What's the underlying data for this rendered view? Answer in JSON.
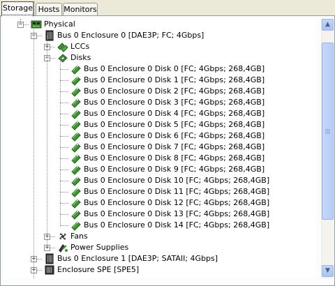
{
  "tabs": [
    {
      "label": "Storage",
      "active": true
    },
    {
      "label": "Hosts",
      "active": false
    },
    {
      "label": "Monitors",
      "active": false
    }
  ],
  "tree": {
    "root": {
      "label": "Physical",
      "icon": "board-icon",
      "expanded": true
    },
    "enclosure0": {
      "label": "Bus 0 Enclosure 0 [DAE3P; FC; 4Gbps]",
      "icon": "enclosure-icon",
      "expanded": true
    },
    "lccs": {
      "label": "LCCs",
      "icon": "lcc-icon",
      "expanded": false
    },
    "disks": {
      "label": "Disks",
      "icon": "disks-group-icon",
      "expanded": true
    },
    "disk_items": [
      "Bus 0 Enclosure 0 Disk 0 [FC; 4Gbps; 268,4GB]",
      "Bus 0 Enclosure 0 Disk 1 [FC; 4Gbps; 268,4GB]",
      "Bus 0 Enclosure 0 Disk 2 [FC; 4Gbps; 268,4GB]",
      "Bus 0 Enclosure 0 Disk 3 [FC; 4Gbps; 268,4GB]",
      "Bus 0 Enclosure 0 Disk 4 [FC; 4Gbps; 268,4GB]",
      "Bus 0 Enclosure 0 Disk 5 [FC; 4Gbps; 268,4GB]",
      "Bus 0 Enclosure 0 Disk 6 [FC; 4Gbps; 268,4GB]",
      "Bus 0 Enclosure 0 Disk 7 [FC; 4Gbps; 268,4GB]",
      "Bus 0 Enclosure 0 Disk 8 [FC; 4Gbps; 268,4GB]",
      "Bus 0 Enclosure 0 Disk 9 [FC; 4Gbps; 268,4GB]",
      "Bus 0 Enclosure 0 Disk 10 [FC; 4Gbps; 268,4GB]",
      "Bus 0 Enclosure 0 Disk 11 [FC; 4Gbps; 268,4GB]",
      "Bus 0 Enclosure 0 Disk 12 [FC; 4Gbps; 268,4GB]",
      "Bus 0 Enclosure 0 Disk 13 [FC; 4Gbps; 268,4GB]",
      "Bus 0 Enclosure 0 Disk 14 [FC; 4Gbps; 268,4GB]"
    ],
    "disk_icon": "disk-icon",
    "fans": {
      "label": "Fans",
      "icon": "fan-icon",
      "expanded": false
    },
    "power": {
      "label": "Power Supplies",
      "icon": "power-supply-icon",
      "expanded": false
    },
    "enclosure1": {
      "label": "Bus 0 Enclosure 1 [DAE3P; SATAII; 4Gbps]",
      "icon": "enclosure-icon",
      "expanded": false
    },
    "spe": {
      "label": "Enclosure SPE [SPE5]",
      "icon": "spe-enclosure-icon",
      "expanded": false
    }
  },
  "scrollbar": {
    "up_icon": "scroll-up-icon",
    "down_icon": "scroll-down-icon",
    "position_fraction": 0.2,
    "visible_fraction": 0.75
  },
  "colors": {
    "accent": "#316ac5",
    "disk_green": "#3c9a2c",
    "tree_bg": "#ffffff",
    "chrome": "#ece9d8"
  }
}
